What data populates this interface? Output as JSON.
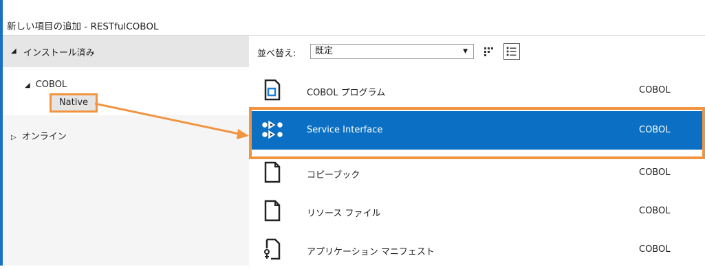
{
  "window": {
    "title": "新しい項目の追加 - RESTfulCOBOL"
  },
  "left_pane": {
    "installed_header": "インストール済み",
    "tree_cobol": "COBOL",
    "tree_native": "Native",
    "tree_online": "オンライン"
  },
  "toolbar": {
    "sort_label": "並べ替え:",
    "sort_value": "既定"
  },
  "items": [
    {
      "name": "COBOL プログラム",
      "language": "COBOL",
      "icon": "cobol-program-icon",
      "selected": false
    },
    {
      "name": "Service Interface",
      "language": "COBOL",
      "icon": "service-interface-icon",
      "selected": true
    },
    {
      "name": "コピーブック",
      "language": "COBOL",
      "icon": "copybook-icon",
      "selected": false
    },
    {
      "name": "リソース ファイル",
      "language": "COBOL",
      "icon": "resource-file-icon",
      "selected": false
    },
    {
      "name": "アプリケーション マニフェスト",
      "language": "COBOL",
      "icon": "app-manifest-icon",
      "selected": false
    }
  ],
  "colors": {
    "selection": "#0b70c4",
    "highlight_outline": "#f19440",
    "window_border": "#1c70c3"
  }
}
